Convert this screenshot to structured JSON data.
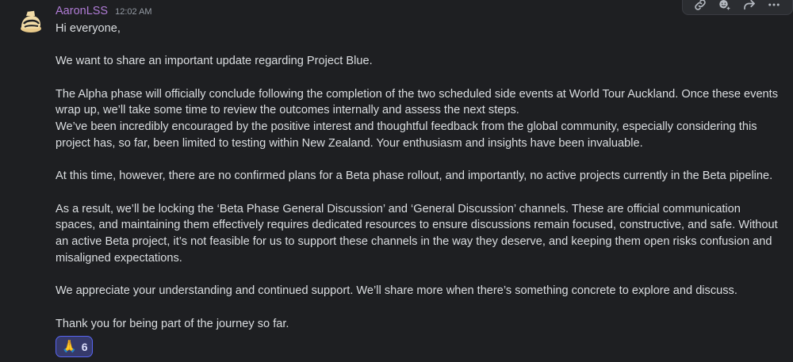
{
  "message": {
    "author": "AaronLSS",
    "timestamp": "12:02 AM",
    "avatar_icon": "golden-helmet-logo",
    "paragraphs": [
      [
        "Hi everyone,"
      ],
      [
        "We want to share an important update regarding Project Blue."
      ],
      [
        "The Alpha phase will officially conclude following the completion of the two scheduled side events at World Tour Auckland. Once these events wrap up, we’ll take some time to review the outcomes internally and assess the next steps.",
        "We’ve been incredibly encouraged by the positive interest and thoughtful feedback from the global community, especially considering this project has, so far, been limited to testing within New Zealand. Your enthusiasm and insights have been invaluable."
      ],
      [
        "At this time, however, there are no confirmed plans for a Beta phase rollout, and importantly, no active projects currently in the Beta pipeline."
      ],
      [
        "As a result, we’ll be locking the ‘Beta Phase General Discussion’ and ‘General Discussion’ channels. These are official communication spaces, and maintaining them effectively requires dedicated resources to ensure discussions remain focused, constructive, and safe. Without an active Beta project, it’s not feasible for us to support these channels in the way they deserve, and keeping them open risks confusion and misaligned expectations."
      ],
      [
        "We appreciate your understanding and continued support. We’ll share more when there’s something concrete to explore and discuss."
      ],
      [
        "Thank you for being part of the journey so far."
      ]
    ],
    "reaction": {
      "emoji": "🙏",
      "count": "6"
    }
  },
  "toolbar": {
    "icons": [
      "link-icon",
      "add-reaction-icon",
      "reply-icon",
      "more-options-icon"
    ]
  },
  "colors": {
    "background": "#1e1f22",
    "username": "#b07cd6",
    "text": "#dbdee1",
    "timestamp": "#949ba4",
    "reaction_bg": "#363a6b",
    "reaction_border": "#5865f2"
  }
}
